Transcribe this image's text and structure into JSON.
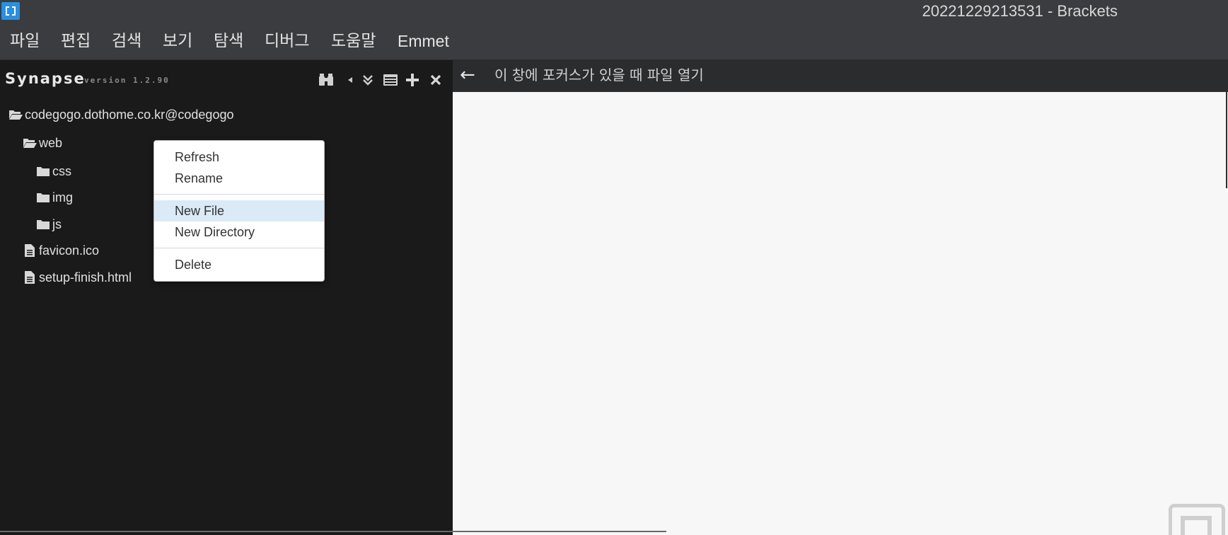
{
  "window": {
    "title": "20221229213531 - Brackets"
  },
  "menubar": {
    "items": [
      {
        "label": "파일"
      },
      {
        "label": "편집"
      },
      {
        "label": "검색"
      },
      {
        "label": "보기"
      },
      {
        "label": "탐색"
      },
      {
        "label": "디버그"
      },
      {
        "label": "도움말"
      },
      {
        "label": "Emmet"
      }
    ]
  },
  "sidebar": {
    "title": "Synapse",
    "version": "version 1.2.90",
    "tools": [
      {
        "icon": "binoculars-icon"
      },
      {
        "icon": "caret-left-icon"
      },
      {
        "icon": "double-chevron-down-icon"
      },
      {
        "icon": "list-window-icon"
      },
      {
        "icon": "plus-icon"
      },
      {
        "icon": "close-icon"
      }
    ],
    "tree": [
      {
        "label": "codegogo.dothome.co.kr@codegogo",
        "type": "folder-open"
      },
      {
        "label": "web",
        "type": "folder-open"
      },
      {
        "label": "css",
        "type": "folder"
      },
      {
        "label": "img",
        "type": "folder"
      },
      {
        "label": "js",
        "type": "folder"
      },
      {
        "label": "favicon.ico",
        "type": "file"
      },
      {
        "label": "setup-finish.html",
        "type": "file"
      }
    ]
  },
  "editor": {
    "back_arrow": "←",
    "header_text": "이 창에 포커스가 있을 때 파일 열기"
  },
  "context_menu": {
    "items": [
      {
        "label": "Refresh",
        "highlighted": false
      },
      {
        "label": "Rename",
        "highlighted": false
      },
      {
        "label": "New File",
        "highlighted": true
      },
      {
        "label": "New Directory",
        "highlighted": false
      },
      {
        "label": "Delete",
        "highlighted": false
      }
    ]
  },
  "colors": {
    "accent": "#2b8fe0",
    "menu_highlight": "#dbeaf7",
    "sidebar_bg": "#1a1a1b",
    "editor_bg": "#f7f7f7"
  }
}
